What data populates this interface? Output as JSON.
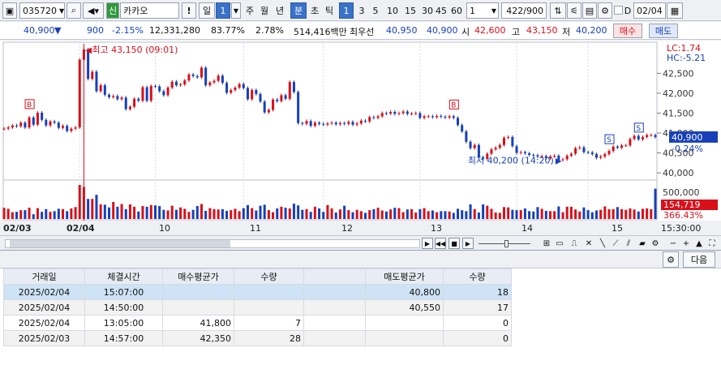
{
  "toolbar": {
    "code": "035720",
    "name": "카카오",
    "badge": "신",
    "period_day": "일",
    "period_num": "1",
    "p_week": "주",
    "p_month": "월",
    "p_year": "년",
    "p_min": "분",
    "p_sec": "초",
    "p_tick": "틱",
    "mins": [
      "1",
      "3",
      "5",
      "10",
      "15",
      "30",
      "45",
      "60"
    ],
    "select_val": "1",
    "count": "422",
    "count_total": "/900",
    "d_label": "D",
    "date": "02/04",
    "excl": "!"
  },
  "quote": {
    "price": "40,900",
    "arrow": "▼",
    "change": "900",
    "pct": "-2.15%",
    "volume": "12,331,280",
    "ratio": "83.77%",
    "turnover": "2.78%",
    "amount": "514,416백만",
    "best_label": "최우선",
    "best_ask": "40,950",
    "best_bid": "40,900",
    "open_label": "시",
    "open": "42,600",
    "high_label": "고",
    "high": "43,150",
    "low_label": "저",
    "low": "40,200",
    "buy": "매수",
    "sell": "매도"
  },
  "chart_data": {
    "type": "line",
    "x_labels": [
      "02/03",
      "02/04",
      "10",
      "11",
      "12",
      "13",
      "14",
      "15",
      "15:30:00"
    ],
    "y_ticks": [
      "42,500",
      "42,000",
      "41,500",
      "41,000",
      "40,500",
      "40,000"
    ],
    "ylim": [
      39900,
      43200
    ],
    "vol_ticks": [
      "500,000"
    ],
    "price": [
      41110,
      41140,
      41190,
      41170,
      41260,
      41140,
      41390,
      41210,
      41510,
      41330,
      41190,
      41290,
      41260,
      41130,
      41180,
      41050,
      41110,
      41140,
      42840,
      43100,
      42360,
      42540,
      42050,
      42200,
      41960,
      41900,
      41930,
      41850,
      41890,
      41600,
      41660,
      41860,
      41810,
      42150,
      41810,
      42180,
      42170,
      42050,
      41950,
      42140,
      42290,
      42200,
      42220,
      42320,
      42470,
      42430,
      42400,
      42640,
      42200,
      42270,
      42310,
      42440,
      42260,
      42010,
      42080,
      42140,
      42230,
      42130,
      41850,
      42080,
      41980,
      41790,
      41520,
      41580,
      41840,
      41800,
      41950,
      41860,
      42280,
      42030,
      41250,
      41230,
      41300,
      41180,
      41260,
      41230,
      41210,
      41240,
      41260,
      41220,
      41250,
      41230,
      41280,
      41210,
      41240,
      41310,
      41290,
      41400,
      41380,
      41420,
      41500,
      41490,
      41530,
      41480,
      41500,
      41540,
      41480,
      41490,
      41500,
      41380,
      41420,
      41420,
      41400,
      41430,
      41410,
      41390,
      41420,
      41380,
      41200,
      41040,
      40780,
      40620,
      40700,
      40390,
      40350,
      40480,
      40590,
      40630,
      40700,
      40880,
      40900,
      40670,
      40500,
      40520,
      40490,
      40450,
      40440,
      40410,
      40420,
      40370,
      40410,
      40430,
      40320,
      40340,
      40430,
      40480,
      40620,
      40640,
      40520,
      40510,
      40470,
      40380,
      40410,
      40470,
      40550,
      40660,
      40630,
      40690,
      40690,
      40850,
      40930,
      40840,
      40900,
      40950,
      40950,
      40900
    ],
    "volume": [
      33,
      30,
      20,
      21,
      26,
      26,
      33,
      14,
      32,
      21,
      29,
      21,
      23,
      30,
      29,
      23,
      31,
      35,
      100,
      94,
      59,
      59,
      71,
      43,
      42,
      34,
      50,
      36,
      44,
      29,
      43,
      36,
      22,
      38,
      36,
      41,
      40,
      38,
      27,
      25,
      39,
      27,
      34,
      30,
      21,
      27,
      38,
      44,
      24,
      32,
      29,
      28,
      29,
      24,
      26,
      30,
      23,
      32,
      41,
      32,
      25,
      39,
      42,
      26,
      20,
      31,
      36,
      33,
      31,
      45,
      40,
      27,
      29,
      21,
      36,
      31,
      21,
      41,
      31,
      19,
      28,
      39,
      26,
      20,
      27,
      23,
      18,
      26,
      29,
      33,
      25,
      22,
      28,
      33,
      32,
      20,
      28,
      29,
      19,
      29,
      32,
      23,
      25,
      20,
      23,
      23,
      22,
      18,
      30,
      26,
      23,
      43,
      29,
      19,
      43,
      39,
      30,
      19,
      18,
      35,
      34,
      27,
      26,
      26,
      31,
      23,
      22,
      35,
      30,
      24,
      23,
      23,
      37,
      20,
      36,
      36,
      28,
      22,
      34,
      26,
      20,
      25,
      27,
      37,
      29,
      29,
      35,
      29,
      27,
      31,
      28,
      22,
      30,
      31,
      29,
      89
    ],
    "hi_label": "최고 43,150 (09:01)",
    "lo_label": "최저 40,200 (14:20)",
    "lc": "LC:1.74",
    "hc": "HC:-5.21",
    "cur_price": "40,900",
    "cur_pct": "-0.24%",
    "vol_cur": "154,719",
    "vol_pct": "366.43%",
    "b_marker": "B",
    "s_marker": "S"
  },
  "scroll": {
    "next": "다음"
  },
  "table": {
    "headers": [
      "거래일",
      "체결시간",
      "매수평균가",
      "수량",
      "",
      "매도평균가",
      "수량"
    ],
    "rows": [
      [
        "2025/02/04",
        "15:07:00",
        "",
        "",
        "",
        "40,800",
        "18"
      ],
      [
        "2025/02/04",
        "14:50:00",
        "",
        "",
        "",
        "40,550",
        "17"
      ],
      [
        "2025/02/04",
        "13:05:00",
        "41,800",
        "7",
        "",
        "",
        "0"
      ],
      [
        "2025/02/03",
        "14:57:00",
        "42,350",
        "28",
        "",
        "",
        "0"
      ]
    ]
  }
}
